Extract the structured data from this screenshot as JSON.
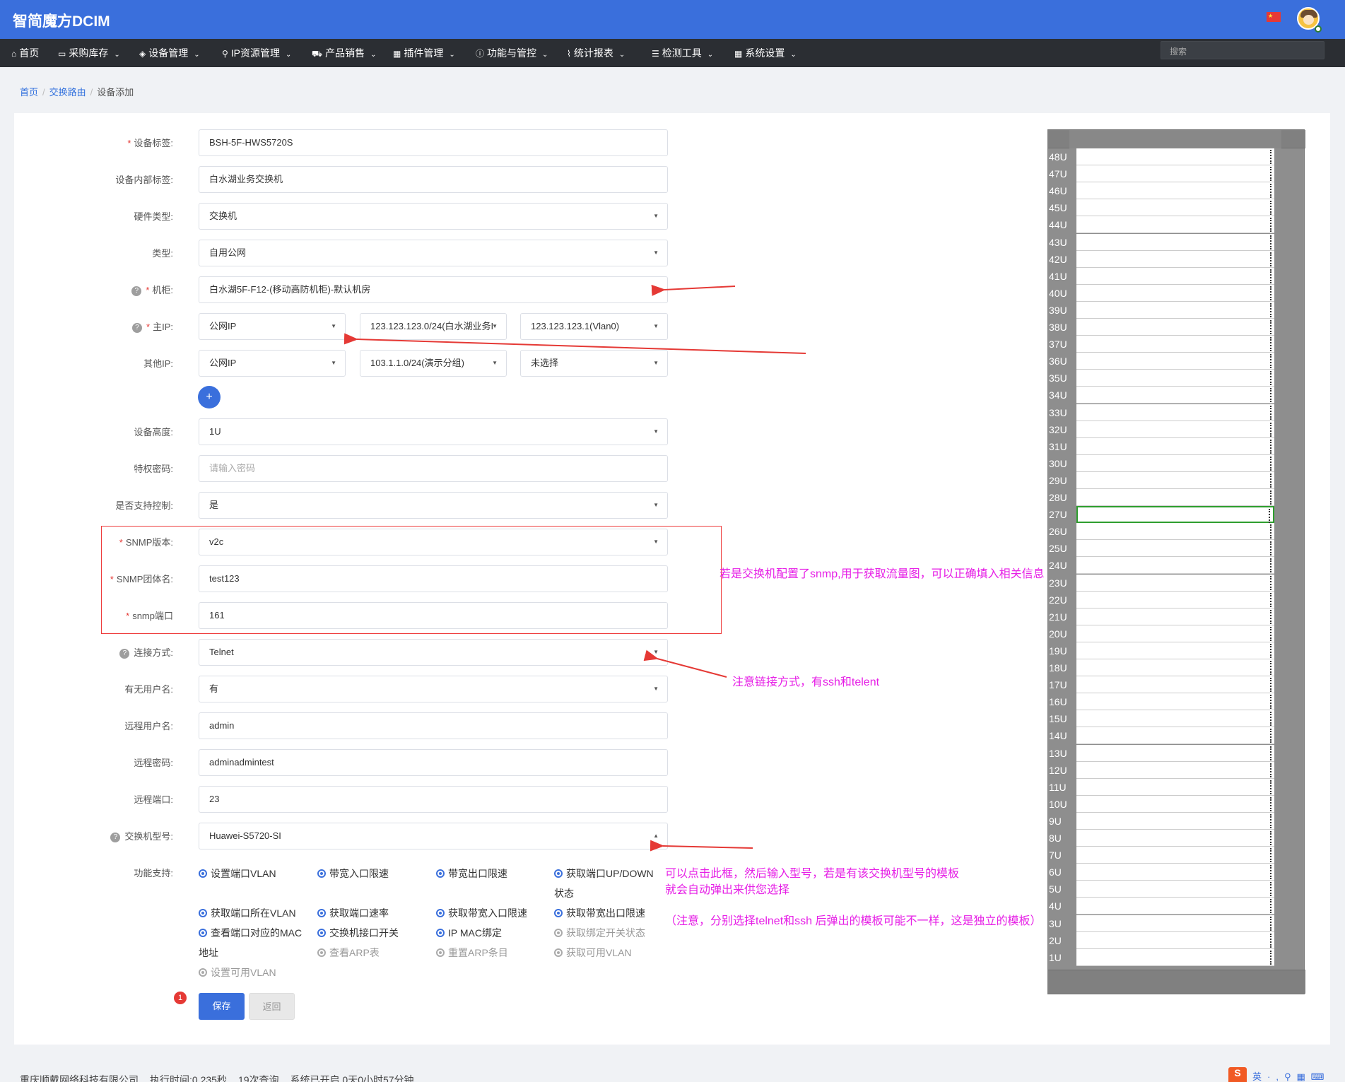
{
  "app": {
    "brand": "智简魔方DCIM",
    "flag_icon": "china-flag-icon",
    "search_placeholder": "搜索"
  },
  "nav": [
    {
      "label": "首页",
      "icon": "home-icon",
      "dropdown": false
    },
    {
      "label": "采购库存",
      "icon": "inbox-icon",
      "dropdown": true
    },
    {
      "label": "设备管理",
      "icon": "cube-icon",
      "dropdown": true
    },
    {
      "label": "IP资源管理",
      "icon": "map-marker-icon",
      "dropdown": true
    },
    {
      "label": "产品销售",
      "icon": "cart-icon",
      "dropdown": true
    },
    {
      "label": "插件管理",
      "icon": "grid-icon",
      "dropdown": true
    },
    {
      "label": "功能与管控",
      "icon": "info-icon",
      "dropdown": true
    },
    {
      "label": "统计报表",
      "icon": "chart-icon",
      "dropdown": true
    },
    {
      "label": "检测工具",
      "icon": "list-icon",
      "dropdown": true
    },
    {
      "label": "系统设置",
      "icon": "grid-icon",
      "dropdown": true
    }
  ],
  "breadcrumb": {
    "home": "首页",
    "section": "交换路由",
    "current": "设备添加",
    "sep": "/"
  },
  "form": {
    "device_tag": {
      "label": "设备标签:",
      "value": "BSH-5F-HWS5720S"
    },
    "internal_tag": {
      "label": "设备内部标签:",
      "value": "白水湖业务交换机"
    },
    "hardware_type": {
      "label": "硬件类型:",
      "value": "交换机"
    },
    "type": {
      "label": "类型:",
      "value": "自用公网"
    },
    "cabinet": {
      "label": "机柜:",
      "value": "白水湖5F-F12-(移动高防机柜)-默认机房"
    },
    "main_ip": {
      "label": "主IP:",
      "kind": "公网IP",
      "subnet": "123.123.123.0/24(白水湖业务I",
      "ip": "123.123.123.1(Vlan0)"
    },
    "other_ip": {
      "label": "其他IP:",
      "kind": "公网IP",
      "subnet": "103.1.1.0/24(演示分组)",
      "ip": "未选择"
    },
    "add_button": "+",
    "height": {
      "label": "设备高度:",
      "value": "1U"
    },
    "priv_password": {
      "label": "特权密码:",
      "placeholder": "请输入密码"
    },
    "control": {
      "label": "是否支持控制:",
      "value": "是"
    },
    "snmp_version": {
      "label": "SNMP版本:",
      "value": "v2c"
    },
    "snmp_community": {
      "label": "SNMP团体名:",
      "value": "test123"
    },
    "snmp_port": {
      "label": "snmp端口",
      "value": "161"
    },
    "connect": {
      "label": "连接方式:",
      "value": "Telnet"
    },
    "has_user": {
      "label": "有无用户名:",
      "value": "有"
    },
    "remote_user": {
      "label": "远程用户名:",
      "value": "admin"
    },
    "remote_pass": {
      "label": "远程密码:",
      "value": "adminadmintest"
    },
    "remote_port": {
      "label": "远程端口:",
      "value": "23"
    },
    "switch_model": {
      "label": "交换机型号:",
      "value": "Huawei-S5720-SI"
    },
    "features_label": "功能支持:",
    "features": [
      {
        "label": "设置端口VLAN",
        "enabled": true
      },
      {
        "label": "带宽入口限速",
        "enabled": true
      },
      {
        "label": "带宽出口限速",
        "enabled": true
      },
      {
        "label": "获取端口UP/DOWN",
        "label2": "状态",
        "enabled": true
      },
      {
        "label": "获取端口所在VLAN",
        "enabled": true
      },
      {
        "label": "获取端口速率",
        "enabled": true
      },
      {
        "label": "获取带宽入口限速",
        "enabled": true
      },
      {
        "label": "获取带宽出口限速",
        "enabled": true
      },
      {
        "label": "查看端口对应的MAC",
        "label2": "地址",
        "enabled": true
      },
      {
        "label": "交换机接口开关",
        "enabled": true
      },
      {
        "label": "IP MAC绑定",
        "enabled": true
      },
      {
        "label": "获取绑定开关状态",
        "enabled": false
      },
      {
        "label": "查看ARP表",
        "enabled": false
      },
      {
        "label": "重置ARP条目",
        "enabled": false
      },
      {
        "label": "获取可用VLAN",
        "enabled": false
      },
      {
        "label": "设置可用VLAN",
        "enabled": false
      }
    ],
    "save": "保存",
    "back": "返回",
    "badge": "1"
  },
  "notes": {
    "snmp": "若是交换机配置了snmp,用于获取流量图，可以正确填入相关信息",
    "connect": "注意链接方式，有ssh和telent",
    "model_1": "可以点击此框，然后输入型号，若是有该交换机型号的模板",
    "model_2": "就会自动弹出来供您选择",
    "model_3": "（注意，分别选择telnet和ssh 后弹出的模板可能不一样，这是独立的模板）",
    "color": "#e61ee6"
  },
  "rack": {
    "units": [
      "48U",
      "47U",
      "46U",
      "45U",
      "44U",
      "43U",
      "42U",
      "41U",
      "40U",
      "39U",
      "38U",
      "37U",
      "36U",
      "35U",
      "34U",
      "33U",
      "32U",
      "31U",
      "30U",
      "29U",
      "28U",
      "27U",
      "26U",
      "25U",
      "24U",
      "23U",
      "22U",
      "21U",
      "20U",
      "19U",
      "18U",
      "17U",
      "16U",
      "15U",
      "14U",
      "13U",
      "12U",
      "11U",
      "10U",
      "9U",
      "8U",
      "7U",
      "6U",
      "5U",
      "4U",
      "3U",
      "2U",
      "1U"
    ],
    "selected": "27U"
  },
  "footer": {
    "company": "重庆顺戴网络科技有限公司",
    "exec_time": "执行时间:0.235秒",
    "queries": "19次查询",
    "uptime": "系统已开启 0天0小时57分钟"
  },
  "colors": {
    "primary": "#3a6fdc",
    "nav_bg": "#2b2e33",
    "required": "#e53935",
    "annotation": "#e61ee6",
    "highlight_box": "#ee3b3b",
    "rack_selected": "#2e9e2e"
  }
}
